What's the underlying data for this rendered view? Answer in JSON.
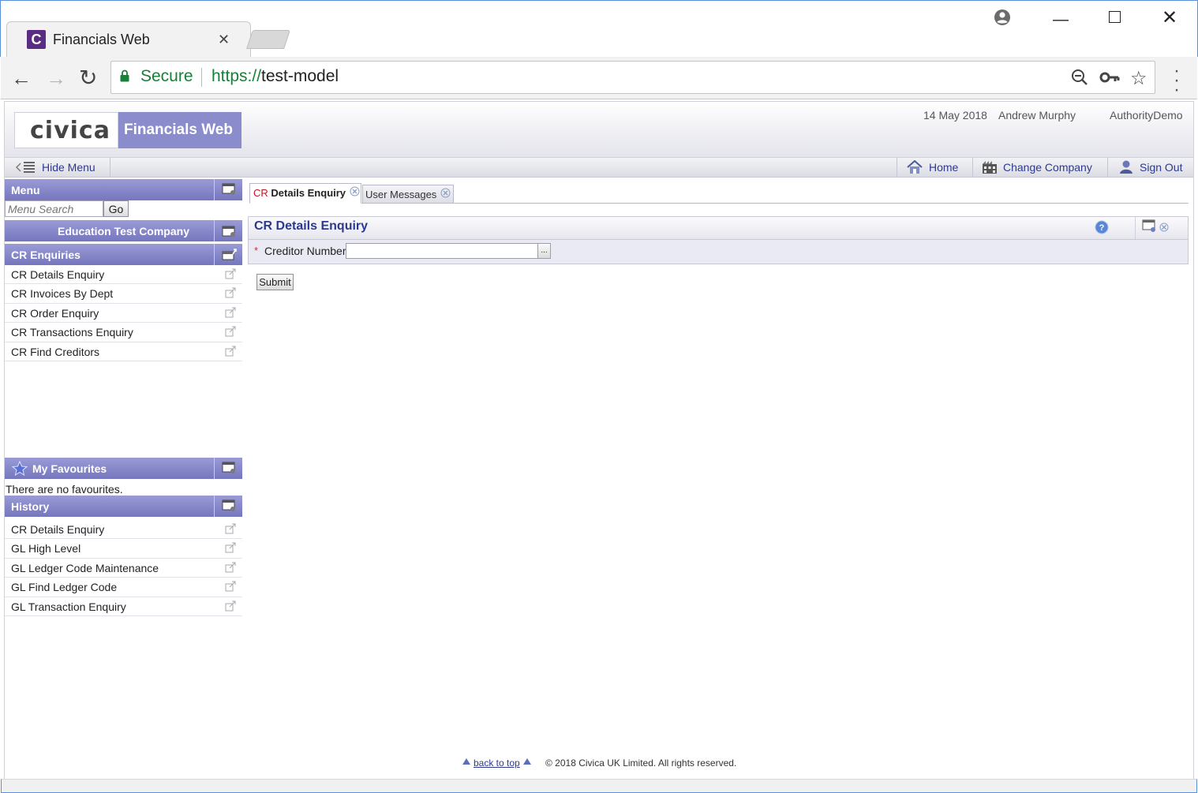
{
  "browser": {
    "tab_title": "Financials Web",
    "tab_favicon_letter": "C",
    "tab_close": "✕",
    "secure_label": "Secure",
    "url_scheme": "https://",
    "url_host": "test-model"
  },
  "header": {
    "logo": "civica",
    "product": "Financials Web",
    "date": "14 May 2018",
    "user": "Andrew Murphy",
    "authority": "AuthorityDemo"
  },
  "navbar": {
    "hide_menu": "Hide Menu",
    "home": "Home",
    "change_company": "Change Company",
    "sign_out": "Sign Out"
  },
  "sidebar": {
    "menu_title": "Menu",
    "search_placeholder": "Menu Search",
    "search_button": "Go",
    "company": "Education Test Company",
    "section_title": "CR Enquiries",
    "items": [
      "CR Details Enquiry",
      "CR Invoices By Dept",
      "CR Order Enquiry",
      "CR Transactions Enquiry",
      "CR Find Creditors"
    ],
    "favourites_title": "My Favourites",
    "favourites_empty": "There are no favourites.",
    "history_title": "History",
    "history": [
      "CR Details Enquiry",
      "GL High Level",
      "GL Ledger Code Maintenance",
      "GL Find Ledger Code",
      "GL Transaction Enquiry"
    ]
  },
  "main": {
    "tabs": [
      {
        "prefix": "CR",
        "rest": " Details Enquiry"
      },
      {
        "label": "User Messages"
      }
    ],
    "form_title": "CR Details Enquiry",
    "required_mark": "*",
    "creditor_label": "Creditor Number",
    "creditor_value": "",
    "lookup_label": "...",
    "submit_label": "Submit"
  },
  "footer": {
    "back_to_top": "back to top",
    "copyright": "© 2018 Civica UK Limited. All rights reserved."
  },
  "colors": {
    "brand_purple": "#8b8ccc",
    "panel_header": "#7576bd",
    "link_blue": "#2b3a8f",
    "secure_green": "#188038",
    "required_red": "#d03030"
  }
}
